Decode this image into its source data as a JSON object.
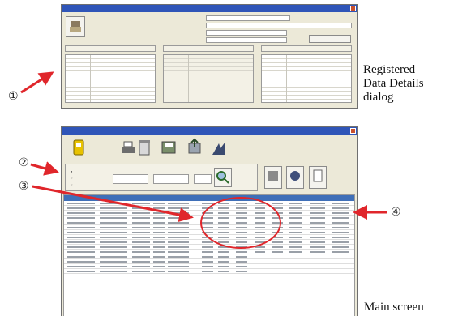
{
  "callouts": {
    "one": "①",
    "two": "②",
    "three": "③",
    "four": "④"
  },
  "captions": {
    "dialog_line1": "Registered",
    "dialog_line2": "Data Details",
    "dialog_line3": "dialog",
    "main": "Main screen"
  },
  "colors": {
    "arrow": "#e0262b",
    "highlight_ellipse": "#e0262b",
    "titlebar": "#2f55b8",
    "window_bg": "#ece9d8"
  },
  "toolbar": {
    "icons": [
      "device-icon",
      "print-icon",
      "delete-icon",
      "save-icon",
      "export-icon",
      "chart-icon"
    ]
  }
}
